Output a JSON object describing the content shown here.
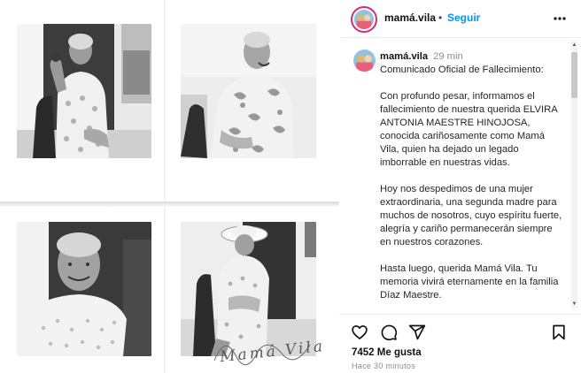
{
  "post": {
    "username": "mamá.vila",
    "follow_label": "Seguir",
    "separator": "•",
    "more_icon": "more-horizontal-icon",
    "caption": {
      "username": "mamá.vila",
      "time": "29 min",
      "paragraphs": [
        "Comunicado Oficial de Fallecimiento:",
        "Con profundo pesar, informamos el fallecimiento de nuestra querida ELVIRA ANTONIA MAESTRE HINOJOSA, conocida cariñosamente como Mamá Vila, quien ha dejado un legado imborrable en nuestras vidas.",
        "Hoy nos despedimos de una mujer extraordinaria, una segunda madre para muchos de nosotros, cuyo espíritu fuerte, alegría y cariño permanecerán siempre en nuestros corazones.",
        "Hasta luego, querida Mamá Vila. Tu memoria vivirá eternamente en la familia Díaz Maestre."
      ]
    },
    "actions": {
      "like_icon": "heart-icon",
      "comment_icon": "comment-icon",
      "share_icon": "send-icon",
      "save_icon": "bookmark-icon"
    },
    "likes": "7452 Me gusta",
    "timestamp": "Hace 30 minutos"
  },
  "media": {
    "signature": "Mamá Vila",
    "photos": [
      "photo-elderly-woman-waving",
      "photo-elderly-woman-laughing",
      "photo-elderly-woman-portrait",
      "photo-elderly-woman-hat"
    ]
  },
  "colors": {
    "accent": "#0095f6",
    "story_ring": "#d62976",
    "muted": "#8e8e8e"
  }
}
